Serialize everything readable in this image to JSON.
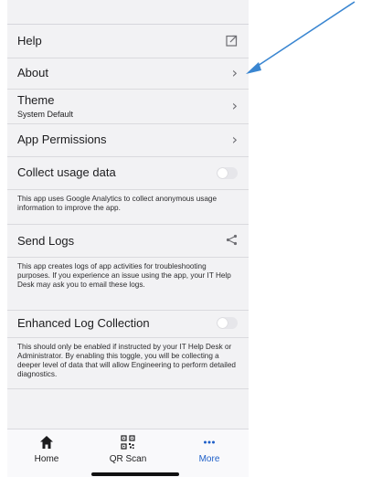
{
  "settings": {
    "help": {
      "label": "Help",
      "icon": "external-link-icon"
    },
    "about": {
      "label": "About",
      "icon": "chevron-right-icon"
    },
    "theme": {
      "label": "Theme",
      "value": "System Default",
      "icon": "chevron-right-icon"
    },
    "app_permissions": {
      "label": "App Permissions",
      "icon": "chevron-right-icon"
    },
    "collect_usage": {
      "label": "Collect usage data",
      "enabled": false,
      "description": "This app uses Google Analytics to collect anonymous usage information to improve the app."
    },
    "send_logs": {
      "label": "Send Logs",
      "icon": "share-icon",
      "description": "This app creates logs of app activities for troubleshooting purposes. If you experience an issue using the app, your IT Help Desk may ask you to email these logs."
    },
    "enhanced_log": {
      "label": "Enhanced Log Collection",
      "enabled": false,
      "description": "This should only be enabled if instructed by your IT Help Desk or Administrator. By enabling this toggle, you will be collecting a deeper level of data that will allow Engineering to perform detailed diagnostics."
    }
  },
  "tabbar": {
    "home": {
      "label": "Home",
      "icon": "home-icon"
    },
    "qr_scan": {
      "label": "QR Scan",
      "icon": "qr-code-icon"
    },
    "more": {
      "label": "More",
      "icon": "ellipsis-icon",
      "active": true
    }
  },
  "colors": {
    "background": "#f2f2f4",
    "accent": "#1e5fc8",
    "annotation_arrow": "#3a86d1"
  }
}
